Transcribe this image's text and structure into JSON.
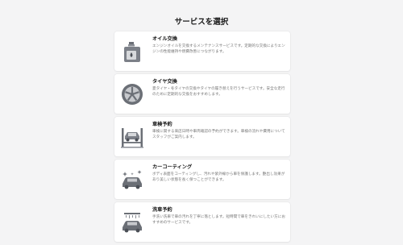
{
  "page": {
    "title": "サービスを選択"
  },
  "services": [
    {
      "id": "oil",
      "icon": "oil-can-icon",
      "name": "オイル交換",
      "description": "エンジンオイルを交換するメンテナンスサービスです。定期的な交換によりエンジンの性能維持や燃費改善につながります。"
    },
    {
      "id": "tire",
      "icon": "tire-wheel-icon",
      "name": "タイヤ交換",
      "description": "夏タイヤ・冬タイヤの交換やタイヤの履き替えを行うサービスです。安全な走行のために定期的な交換をおすすめします。"
    },
    {
      "id": "inspection",
      "icon": "car-lift-icon",
      "name": "車検予約",
      "description": "車検に関する来店日時や車両確認の予約ができます。車検の流れや費用についてスタッフがご案内します。"
    },
    {
      "id": "coating",
      "icon": "car-sparkle-icon",
      "name": "カーコーティング",
      "description": "ボディ表面をコーティングし、汚れや紫外線から車を保護します。艶出し効果があり美しい状態を長く保つことができます。"
    },
    {
      "id": "wash",
      "icon": "car-wash-icon",
      "name": "洗車予約",
      "description": "手洗い洗車で車の汚れを丁寧に落とします。短時間で車をきれいにしたい方におすすめのサービスです。"
    }
  ]
}
